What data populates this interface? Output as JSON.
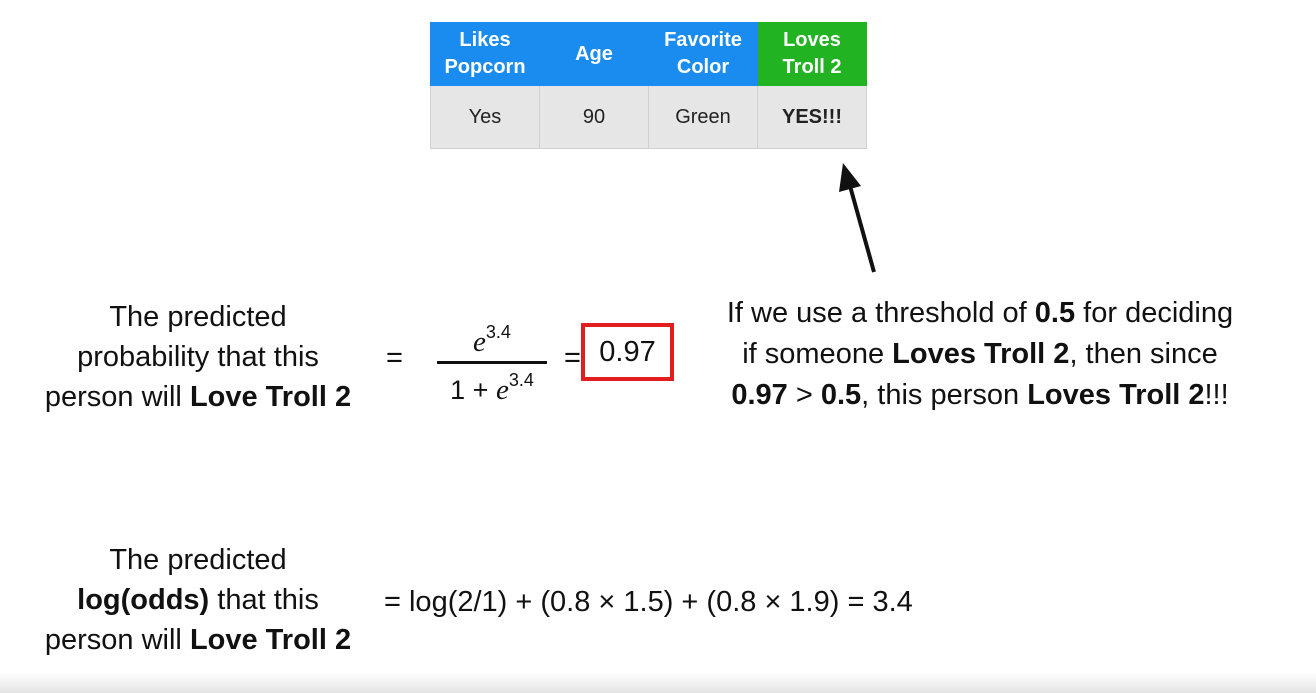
{
  "table": {
    "headers": [
      {
        "line1": "Likes",
        "line2": "Popcorn"
      },
      {
        "line1": "Age",
        "line2": ""
      },
      {
        "line1": "Favorite",
        "line2": "Color"
      },
      {
        "line1": "Loves",
        "line2": "Troll 2"
      }
    ],
    "row": [
      "Yes",
      "90",
      "Green",
      "YES!!!"
    ],
    "colors": {
      "blue": "#1a8cef",
      "green": "#22b322",
      "cell_bg": "#e6e6e6"
    }
  },
  "probability": {
    "label_line1": "The predicted",
    "label_line2": "probability that this",
    "label_line3_prefix": "person will ",
    "label_line3_bold": "Love Troll 2",
    "equals": "=",
    "numerator_base": "e",
    "numerator_exp": "3.4",
    "denominator_prefix": "1 + ",
    "denominator_base": "e",
    "denominator_exp": "3.4",
    "equals2": "=",
    "result": "0.97",
    "result_border_color": "#e01e1e"
  },
  "note": {
    "t1": "If we use a threshold of ",
    "b1": "0.5",
    "t2": " for deciding if someone ",
    "b2": "Loves Troll 2",
    "t3": ", then since ",
    "b3": "0.97",
    "t4": " > ",
    "b4": "0.5",
    "t5": ", this person ",
    "b5": "Loves Troll 2",
    "t6": "!!!"
  },
  "logodds": {
    "label_line1": "The predicted",
    "label_line2_bold": "log(odds)",
    "label_line2_rest": " that this",
    "label_line3_prefix": "person will ",
    "label_line3_bold": "Love Troll 2",
    "equation": "= log(2/1) + (0.8 × 1.5) + (0.8 × 1.9) = 3.4"
  }
}
